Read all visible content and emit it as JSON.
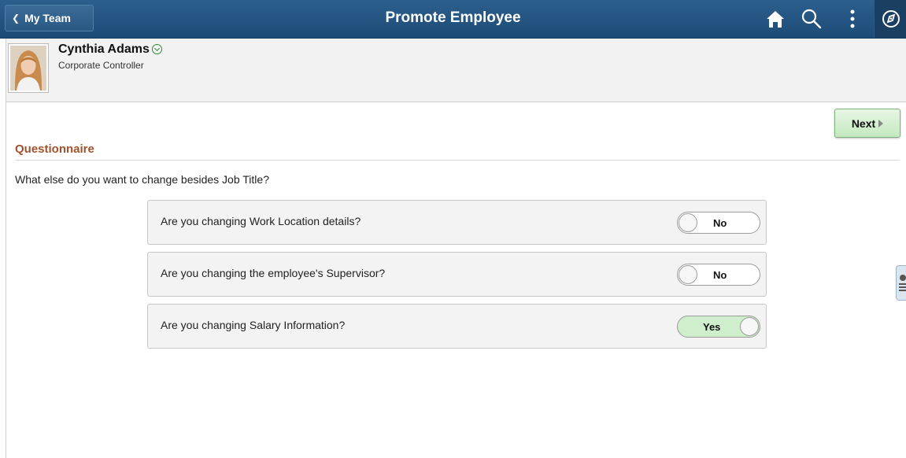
{
  "banner": {
    "back_label": "My Team",
    "title": "Promote Employee",
    "icons": [
      "home-icon",
      "search-icon",
      "actions-menu-icon",
      "navbar-icon"
    ]
  },
  "employee": {
    "name": "Cynthia Adams",
    "job_title": "Corporate Controller"
  },
  "next_label": "Next",
  "section": {
    "title": "Questionnaire",
    "prompt": "What else do you want to change besides Job Title?"
  },
  "questions": [
    {
      "label": "Are you changing Work Location details?",
      "value": "No",
      "on": false
    },
    {
      "label": "Are you changing the employee's Supervisor?",
      "value": "No",
      "on": false
    },
    {
      "label": "Are you changing Salary Information?",
      "value": "Yes",
      "on": true
    }
  ],
  "colors": {
    "banner": "#1d4b77",
    "section_title": "#a0522d",
    "toggle_on": "#cfeecc",
    "next_button": "#c4e8bf"
  }
}
